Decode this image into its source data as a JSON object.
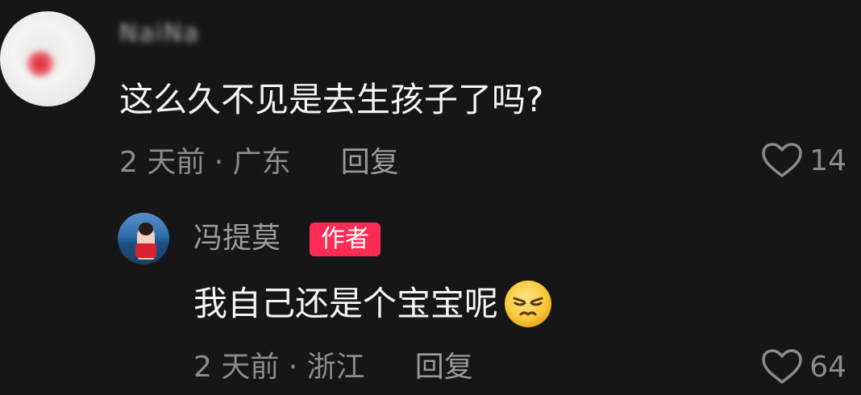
{
  "comments": [
    {
      "username": "NaiNa",
      "text": "这么久不见是去生孩子了吗?",
      "time_location": "2 天前 · 广东",
      "reply_label": "回复",
      "likes": "14"
    },
    {
      "username": "冯提莫",
      "author_badge": "作者",
      "text": "我自己还是个宝宝呢",
      "emoji": "annoyed-face-emoji",
      "time_location": "2 天前 · 浙江",
      "reply_label": "回复",
      "likes": "64"
    }
  ],
  "colors": {
    "background": "#161616",
    "author_badge": "#fe2c55",
    "secondary_text": "#8c8c8c"
  },
  "icons": {
    "like": "heart-outline-icon"
  }
}
